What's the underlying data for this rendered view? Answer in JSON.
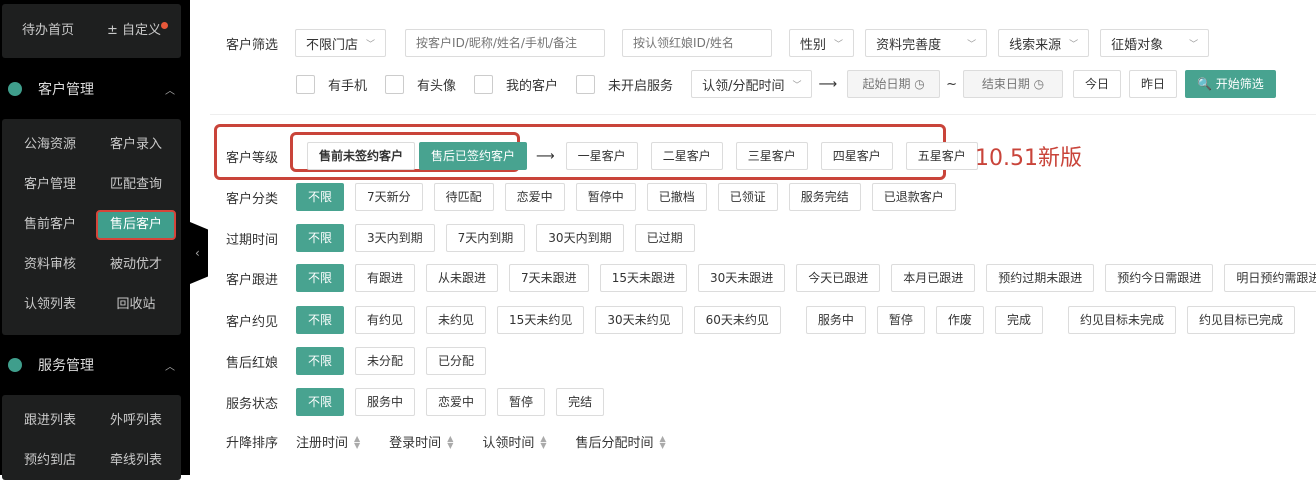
{
  "sidebar": {
    "top": {
      "home": "待办首页",
      "custom": "自定义"
    },
    "customer_mgmt": {
      "title": "客户管理",
      "items": [
        "公海资源",
        "客户录入",
        "客户管理",
        "匹配查询",
        "售前客户",
        "售后客户",
        "资料审核",
        "被动优才",
        "认领列表",
        "回收站"
      ]
    },
    "service_mgmt": {
      "title": "服务管理",
      "items": [
        "跟进列表",
        "外呼列表",
        "预约到店",
        "牵线列表"
      ]
    }
  },
  "filter": {
    "label": "客户筛选",
    "store": "不限门店",
    "search_placeholder": "按客户ID/昵称/姓名/手机/备注",
    "matchmaker_placeholder": "按认领红娘ID/姓名",
    "gender": "性别",
    "completeness": "资料完善度",
    "source": "线索来源",
    "target": "征婚对象",
    "checkboxes": [
      "有手机",
      "有头像",
      "我的客户",
      "未开启服务"
    ],
    "time_type": "认领/分配时间",
    "arrow": "⟶",
    "start_placeholder": "起始日期 ◷",
    "tilde": "~",
    "end_placeholder": "结束日期 ◷",
    "today": "今日",
    "yesterday": "昨日",
    "search_btn": "🔍 开始筛选"
  },
  "level": {
    "label": "客户等级",
    "items": [
      "售前未签约客户",
      "售后已签约客户"
    ],
    "arrow": "⟶",
    "stars": [
      "一星客户",
      "二星客户",
      "三星客户",
      "四星客户",
      "五星客户"
    ],
    "version_note": "10.51新版"
  },
  "rows": [
    {
      "label": "客户分类",
      "items": [
        "不限",
        "7天新分",
        "待匹配",
        "恋爱中",
        "暂停中",
        "已撤档",
        "已领证",
        "服务完结",
        "已退款客户"
      ]
    },
    {
      "label": "过期时间",
      "items": [
        "不限",
        "3天内到期",
        "7天内到期",
        "30天内到期",
        "已过期"
      ]
    },
    {
      "label": "客户跟进",
      "items": [
        "不限",
        "有跟进",
        "从未跟进",
        "7天未跟进",
        "15天未跟进",
        "30天未跟进",
        "今天已跟进",
        "本月已跟进",
        "预约过期未跟进",
        "预约今日需跟进",
        "明日预约需跟进"
      ]
    },
    {
      "label": "客户约见",
      "items": [
        "不限",
        "有约见",
        "未约见",
        "15天未约见",
        "30天未约见",
        "60天未约见"
      ],
      "items2": [
        "服务中",
        "暂停",
        "作废",
        "完成"
      ],
      "items3": [
        "约见目标未完成",
        "约见目标已完成"
      ]
    },
    {
      "label": "售后红娘",
      "items": [
        "不限",
        "未分配",
        "已分配"
      ]
    },
    {
      "label": "服务状态",
      "items": [
        "不限",
        "服务中",
        "恋爱中",
        "暂停",
        "完结"
      ]
    }
  ],
  "sort": {
    "label": "升降排序",
    "items": [
      "注册时间",
      "登录时间",
      "认领时间",
      "售后分配时间"
    ]
  }
}
